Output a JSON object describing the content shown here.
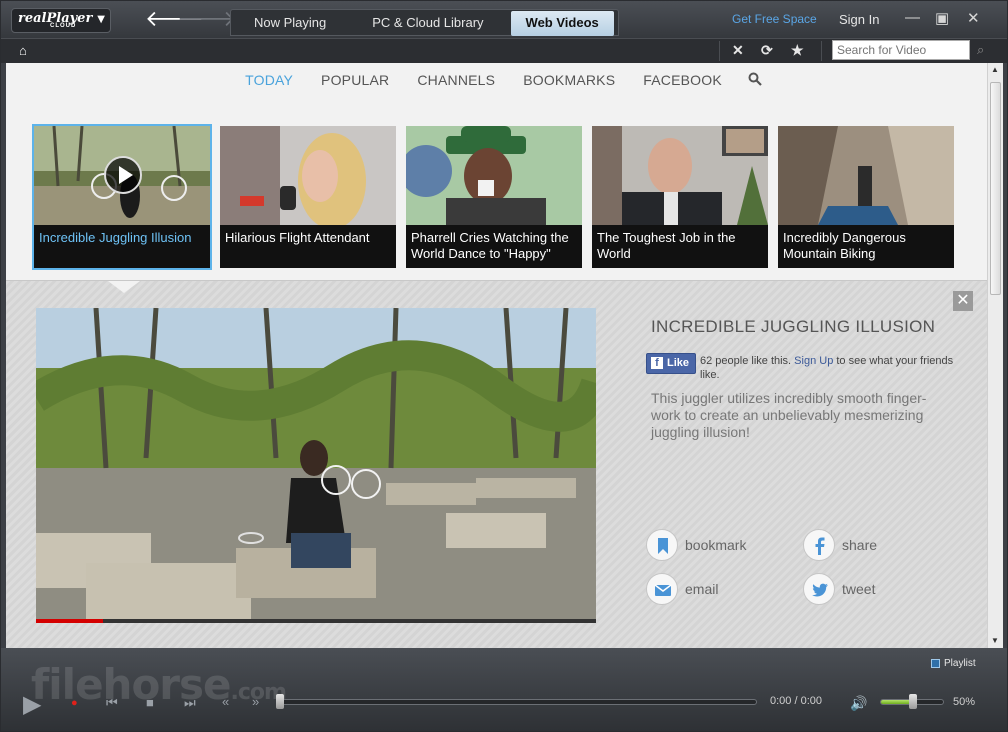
{
  "app": {
    "logo_main": "realPlayer",
    "logo_sub": "CLOUD"
  },
  "tabs": [
    {
      "label": "Now Playing"
    },
    {
      "label": "PC & Cloud Library"
    },
    {
      "label": "Web Videos"
    }
  ],
  "header": {
    "get_free_space": "Get Free Space",
    "sign_in": "Sign In"
  },
  "toolbar": {
    "search_placeholder": "Search for Video"
  },
  "categories": [
    "TODAY",
    "POPULAR",
    "CHANNELS",
    "BOOKMARKS",
    "FACEBOOK"
  ],
  "thumbnails": [
    {
      "caption": "Incredible Juggling Illusion"
    },
    {
      "caption": "Hilarious Flight Attendant"
    },
    {
      "caption": "Pharrell Cries Watching the World Dance to \"Happy\""
    },
    {
      "caption": "The Toughest Job in the World"
    },
    {
      "caption": "Incredibly Dangerous Mountain Biking"
    }
  ],
  "detail": {
    "title": "INCREDIBLE JUGGLING ILLUSION",
    "fb_like_label": "Like",
    "fb_text_pre": "62 people like this. ",
    "fb_signup": "Sign Up",
    "fb_text_post": " to see what your friends like.",
    "description": "This juggler utilizes incredibly smooth finger-work to create an unbelievably mesmerizing juggling illusion!",
    "actions": {
      "bookmark": "bookmark",
      "share": "share",
      "email": "email",
      "tweet": "tweet"
    },
    "progress_fraction": 0.12
  },
  "player": {
    "watermark": "filehorse",
    "watermark_suffix": ".com",
    "playlist": "Playlist",
    "timecode": "0:00 / 0:00",
    "volume_label": "50%",
    "volume_fraction": 0.5
  },
  "colors": {
    "accent": "#4aa3dc",
    "like_blue": "#4a66a7"
  }
}
